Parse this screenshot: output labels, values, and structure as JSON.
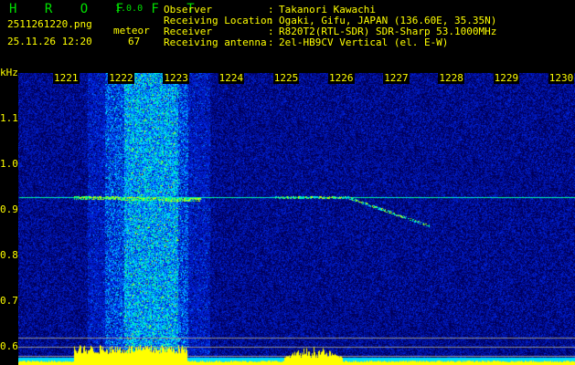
{
  "app": {
    "name": "H R O F F T",
    "version": "1.0.0"
  },
  "file": {
    "name": "2511261220.png",
    "datetime": "25.11.26 12:20"
  },
  "meteor": {
    "label": "meteor",
    "count": "67"
  },
  "info": [
    {
      "label": "Observer",
      "value": "Takanori Kawachi"
    },
    {
      "label": "Receiving Location",
      "value": "Ogaki, Gifu, JAPAN (136.60E, 35.35N)"
    },
    {
      "label": "Receiver",
      "value": "R820T2(RTL-SDR) SDR-Sharp 53.1000MHz"
    },
    {
      "label": "Receiving antenna",
      "value": "2el-HB9CV Vertical (el. E-W)"
    }
  ],
  "axis": {
    "y_unit": "kHz",
    "y_ticks": [
      "1.1",
      "1.0",
      "0.9",
      "0.8",
      "0.7",
      "0.6"
    ],
    "x_ticks": [
      "1221",
      "1222",
      "1223",
      "1224",
      "1225",
      "1226",
      "1227",
      "1228",
      "1229",
      "1230"
    ]
  },
  "colors": {
    "text": "#ffff00",
    "logo": "#00e000",
    "background": "#0010a0",
    "histogram": "#ffff00",
    "baseline": "#00e0ff"
  }
}
